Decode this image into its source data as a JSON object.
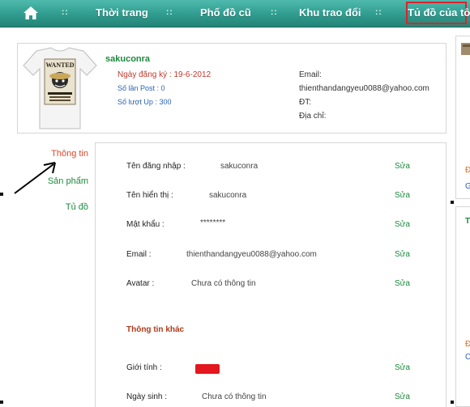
{
  "nav": {
    "items": [
      "Thời trang",
      "Phố đồ cũ",
      "Khu trao đổi"
    ],
    "active": "Tủ đồ của tôi",
    "separator": "::"
  },
  "profile": {
    "username": "sakuconra",
    "joined": "Ngày đăng ký : 19-6-2012",
    "posts": "Số lần Post : 0",
    "ups": "Số lượt Up : 300",
    "avatar_print": "WANTED",
    "email_label": "Email:",
    "email_value": "thienthandangyeu0088@yahoo.com",
    "phone_label": "ĐT:",
    "address_label": "Địa chỉ:"
  },
  "menu": {
    "items": [
      "Thông tin",
      "Sản phẩm",
      "Tủ đồ"
    ],
    "active_index": 0
  },
  "form": {
    "edit_label": "Sửa",
    "rows": [
      {
        "label": "Tên đăng nhập :",
        "value": "sakuconra"
      },
      {
        "label": "Tên hiển thị :",
        "value": "sakuconra"
      },
      {
        "label": "Mật khẩu :",
        "value": "********"
      },
      {
        "label": "Email :",
        "value": "thienthandangyeu0088@yahoo.com"
      },
      {
        "label": "Avatar :",
        "value": "Chưa có thông tin"
      }
    ],
    "section_title": "Thông tin khác",
    "extra_rows": [
      {
        "label": "Giới tính :",
        "value": ""
      },
      {
        "label": "Ngày sinh :",
        "value": "Chưa có thông tin"
      }
    ]
  },
  "right": {
    "t1": "Đ",
    "t2": "G",
    "t3": "T",
    "t4": "Đ",
    "t5": "C"
  },
  "colors": {
    "nav_bg": "#2f9c8f",
    "active_border": "#e0212b",
    "accent_green": "#1b8a3d",
    "active_menu": "#e04a2a"
  }
}
